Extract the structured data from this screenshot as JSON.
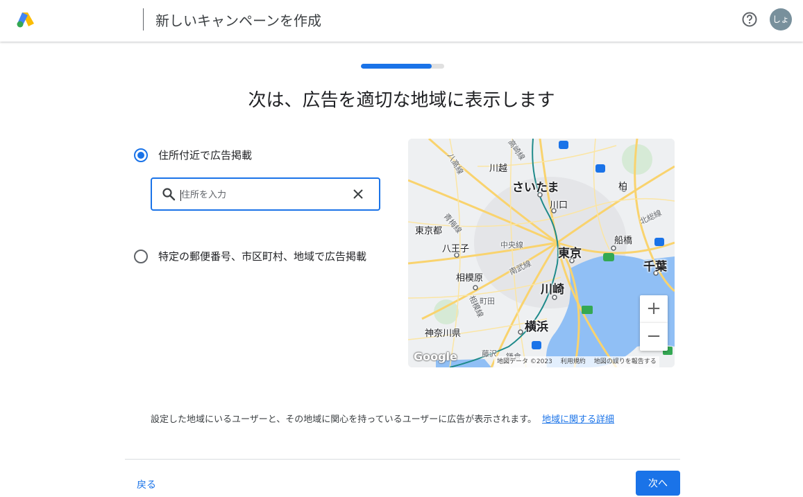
{
  "header": {
    "title": "新しいキャンペーンを作成",
    "avatar_initials": "しょ",
    "help_icon": "help-circle-icon"
  },
  "progress": {
    "value": 0.85
  },
  "heading": "次は、広告を適切な地域に表示します",
  "options": {
    "near_address": {
      "label": "住所付近で広告掲載",
      "selected": true
    },
    "specific_areas": {
      "label": "特定の郵便番号、市区町村、地域で広告掲載",
      "selected": false
    }
  },
  "search": {
    "placeholder": "住所を入力",
    "value": ""
  },
  "map": {
    "labels": {
      "saitama": "さいたま",
      "tokyo": "東京",
      "kawasaki": "川崎",
      "yokohama": "横浜",
      "chiba": "千葉",
      "kawagoe": "川越",
      "kawaguchi": "川口",
      "funabashi": "船橋",
      "hachioji": "八王子",
      "sagamihara": "相模原",
      "tokyo_to": "東京都",
      "kanagawa": "神奈川県",
      "chuo_line": "中央線",
      "nambu_line": "南武線",
      "machida": "町田",
      "kashiwa": "柏",
      "fujisawa": "藤沢",
      "kamakura": "鎌倉",
      "takasaki_line": "高崎線",
      "hachiko_line": "八高線",
      "ome_line": "青梅線",
      "sagami_line": "相模線",
      "hokuso_line": "北総線"
    },
    "zoom_in": "+",
    "zoom_out": "−",
    "google_logo": "Google",
    "attribution": {
      "data": "地図データ ©2023",
      "terms": "利用規約",
      "report": "地図の誤りを報告する"
    }
  },
  "info": {
    "text": "設定した地域にいるユーザーと、その地域に関心を持っているユーザーに広告が表示されます。",
    "link": "地域に関する詳細"
  },
  "footer": {
    "back_label": "戻る",
    "next_label": "次へ"
  },
  "colors": {
    "accent": "#1a73e8",
    "water": "#90bff5",
    "road": "#f9d36e"
  }
}
